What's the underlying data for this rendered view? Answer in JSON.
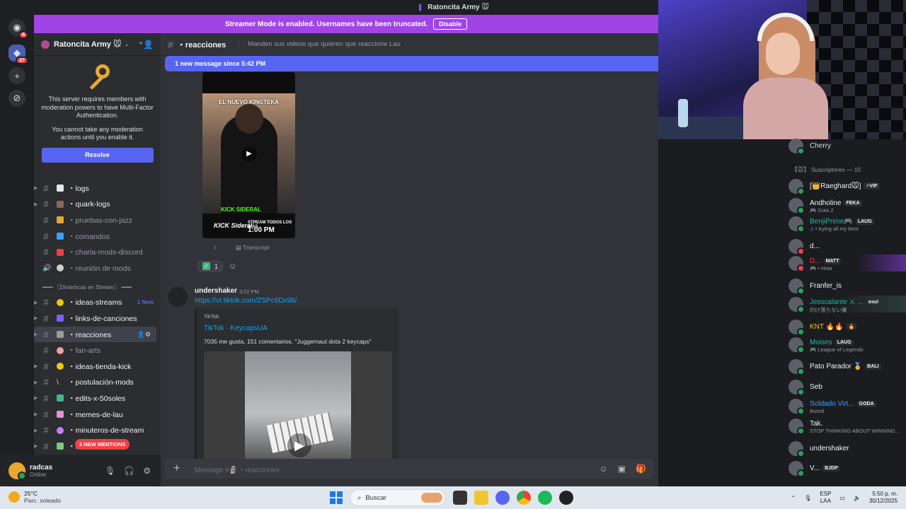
{
  "window": {
    "title": "Ratoncita Army 🐭"
  },
  "rail": {
    "home_badge": "8",
    "server_badge": "27"
  },
  "streamer": {
    "text": "Streamer Mode is enabled. Usernames have been truncated.",
    "button": "Disable"
  },
  "server": {
    "name": "Ratoncita Army 🐭"
  },
  "mfa": {
    "line1": "This server requires members with moderation powers to have Multi-Factor Authentication.",
    "line2": "You cannot take any moderation actions until you enable it.",
    "button": "Resolve"
  },
  "channels_top": [
    {
      "name": "・logs",
      "unread": true
    },
    {
      "name": "・quark-logs",
      "unread": true
    },
    {
      "name": "・pruebas-con-jazz",
      "unread": false
    },
    {
      "name": "・comandos",
      "unread": false
    },
    {
      "name": "・charla-mods-discord",
      "unread": false
    },
    {
      "name": "・reunión de mods",
      "unread": false,
      "voice": true
    }
  ],
  "category": "━━━ 〖Dinámicas en Stream〗 ━━━",
  "channels_bottom": [
    {
      "name": "・ideas-streams",
      "unread": true,
      "new": "1 New"
    },
    {
      "name": "・links-de-canciones",
      "unread": true
    },
    {
      "name": "・reacciones",
      "active": true
    },
    {
      "name": "・fan-arts",
      "unread": false
    },
    {
      "name": "・ideas-tienda-kick",
      "unread": true
    },
    {
      "name": "・postulación-mods",
      "unread": true
    },
    {
      "name": "・edits-x-50soles",
      "unread": true
    },
    {
      "name": "・memes-de-lau",
      "unread": true
    },
    {
      "name": "・minuteros-de-stream",
      "unread": true
    },
    {
      "name": "・f",
      "unread": true
    }
  ],
  "mentions_pill": "2 NEW MENTIONS",
  "user": {
    "name": "radcas",
    "status": "Online"
  },
  "chat": {
    "channel": "・reacciones",
    "topic": "Manden sus videos que quieren que reaccione Lau",
    "new_banner": "1 new message since 5:42 PM",
    "video1": {
      "caption": "EL NUEVO KINGTEKA",
      "kick_sideral": "KICK SIDERAL",
      "stream_text": "STREAM TODOS LOS DIAS",
      "stream_time": "1:00 PM",
      "brand": "KICK Sideral"
    },
    "transcript": "Transcript",
    "info": "i",
    "reaction_count": "1",
    "message": {
      "author": "undershaker",
      "time": "3:22 PM",
      "link": "https://vt.tiktok.com/ZSPc6Dx96/",
      "embed_provider": "TikTok",
      "embed_title": "TikTok · KeycapsUA",
      "embed_desc": "7035 me gusta, 151 comentarios. \"Juggernaut dota 2 keycaps\""
    },
    "composer_placeholder": "Message #🗿・reacciones"
  },
  "members": {
    "top_user": "Cherry",
    "group": "【🐭】 Suscriptores — 15",
    "list": [
      {
        "name": "[👑Raeghard🐭]",
        "tag": "⚡VIP",
        "activity": "",
        "dnd": false
      },
      {
        "name": "Andholine",
        "tag": "FEKA",
        "activity": "🎮 Dota 2",
        "dnd": false
      },
      {
        "name": "BenjiPrime🎮",
        "tag": "LAUG",
        "activity": "♫ • trying all my best",
        "dnd": false
      },
      {
        "name": "d...",
        "tag": "",
        "activity": "",
        "dnd": true
      },
      {
        "name": "D...",
        "tag": "MATT",
        "activity": "🎮 • Hola",
        "dnd": true,
        "hl": true
      },
      {
        "name": "Franfer_is",
        "tag": "",
        "activity": "",
        "dnd": false
      },
      {
        "name": "Jesscalante ⚔ ...",
        "tag": "osu!",
        "activity": "灼け落ちない翼",
        "dnd": false,
        "hl2": true
      },
      {
        "name": "KNT 🔥🔥",
        "tag": "🔥",
        "activity": "",
        "dnd": false
      },
      {
        "name": "Moises",
        "tag": "LAUG",
        "activity": "🎮 League of Legends",
        "dnd": false
      },
      {
        "name": "Pato Parador 🏅",
        "tag": "BALI",
        "activity": "",
        "dnd": false
      },
      {
        "name": "Seb",
        "tag": "",
        "activity": "",
        "dnd": false
      },
      {
        "name": "Soldado Virt...",
        "tag": "GODA",
        "activity": "Bored",
        "dnd": false
      },
      {
        "name": "Tak.",
        "tag": "",
        "activity": "STOP THINKING ABOUT WINNING...",
        "dnd": false
      },
      {
        "name": "undershaker",
        "tag": "",
        "activity": "",
        "dnd": false
      },
      {
        "name": "V...",
        "tag": "BJDP",
        "activity": "",
        "dnd": false
      }
    ],
    "name_colors": [
      "#f2f3f5",
      "#f2f3f5",
      "#1abc9c",
      "#f2f3f5",
      "#f23f43",
      "#f2f3f5",
      "#1abc9c",
      "#f1c40f",
      "#1abc9c",
      "#f2f3f5",
      "#f2f3f5",
      "#3ba0ff",
      "#f2f3f5",
      "#f2f3f5",
      "#f2f3f5"
    ]
  },
  "taskbar": {
    "temp": "25°C",
    "weather": "Parc. soleado",
    "search": "Buscar",
    "lang1": "ESP",
    "lang2": "LAA",
    "time": "5:50 p. m.",
    "date": "30/12/2025"
  },
  "colors": {
    "blurple": "#5865f2",
    "streamer": "#a044e6",
    "link": "#00a8fc"
  }
}
